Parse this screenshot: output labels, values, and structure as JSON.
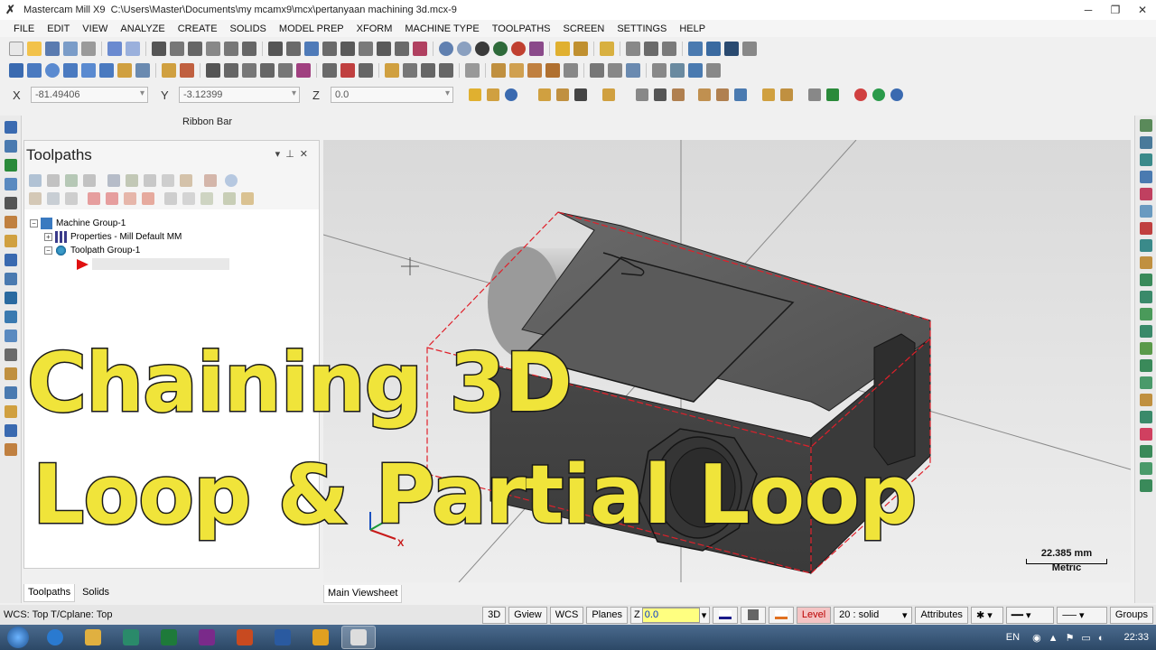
{
  "window": {
    "app": "Mastercam Mill X9",
    "path": "C:\\Users\\Master\\Documents\\my mcamx9\\mcx\\pertanyaan machining 3d.mcx-9"
  },
  "menu": [
    "FILE",
    "EDIT",
    "VIEW",
    "ANALYZE",
    "CREATE",
    "SOLIDS",
    "MODEL PREP",
    "XFORM",
    "MACHINE TYPE",
    "TOOLPATHS",
    "SCREEN",
    "SETTINGS",
    "HELP"
  ],
  "coords": {
    "x_label": "X",
    "x": "-81.49406",
    "y_label": "Y",
    "y": "-3.12399",
    "z_label": "Z",
    "z": "0.0"
  },
  "ribbon_label": "Ribbon Bar",
  "panel": {
    "title": "Toolpaths",
    "tree": [
      {
        "label": "Machine Group-1"
      },
      {
        "label": "Properties - Mill Default MM"
      },
      {
        "label": "Toolpath Group-1"
      }
    ],
    "tabs": [
      "Toolpaths",
      "Solids"
    ]
  },
  "viewport": {
    "tab": "Main Viewsheet",
    "scale_value": "22.385 mm",
    "scale_unit": "Metric",
    "axis_x": "X"
  },
  "overlay": {
    "line1": "Chaining 3D",
    "line2": "Loop & Partial Loop"
  },
  "status": {
    "left": "WCS: Top  T/Cplane: Top",
    "btn_3d": "3D",
    "btn_gview": "Gview",
    "btn_wcs": "WCS",
    "btn_planes": "Planes",
    "z_label": "Z",
    "z_value": "0.0",
    "level_label": "Level",
    "level_value": "20 : solid",
    "attributes": "Attributes",
    "groups": "Groups"
  },
  "taskbar": {
    "lang": "EN",
    "time": "22:33"
  },
  "colors": {
    "overlay_text": "#f0e43a",
    "model": "#4a4a4a",
    "bbox": "#e0202a",
    "accent": "#1e5fb3"
  }
}
